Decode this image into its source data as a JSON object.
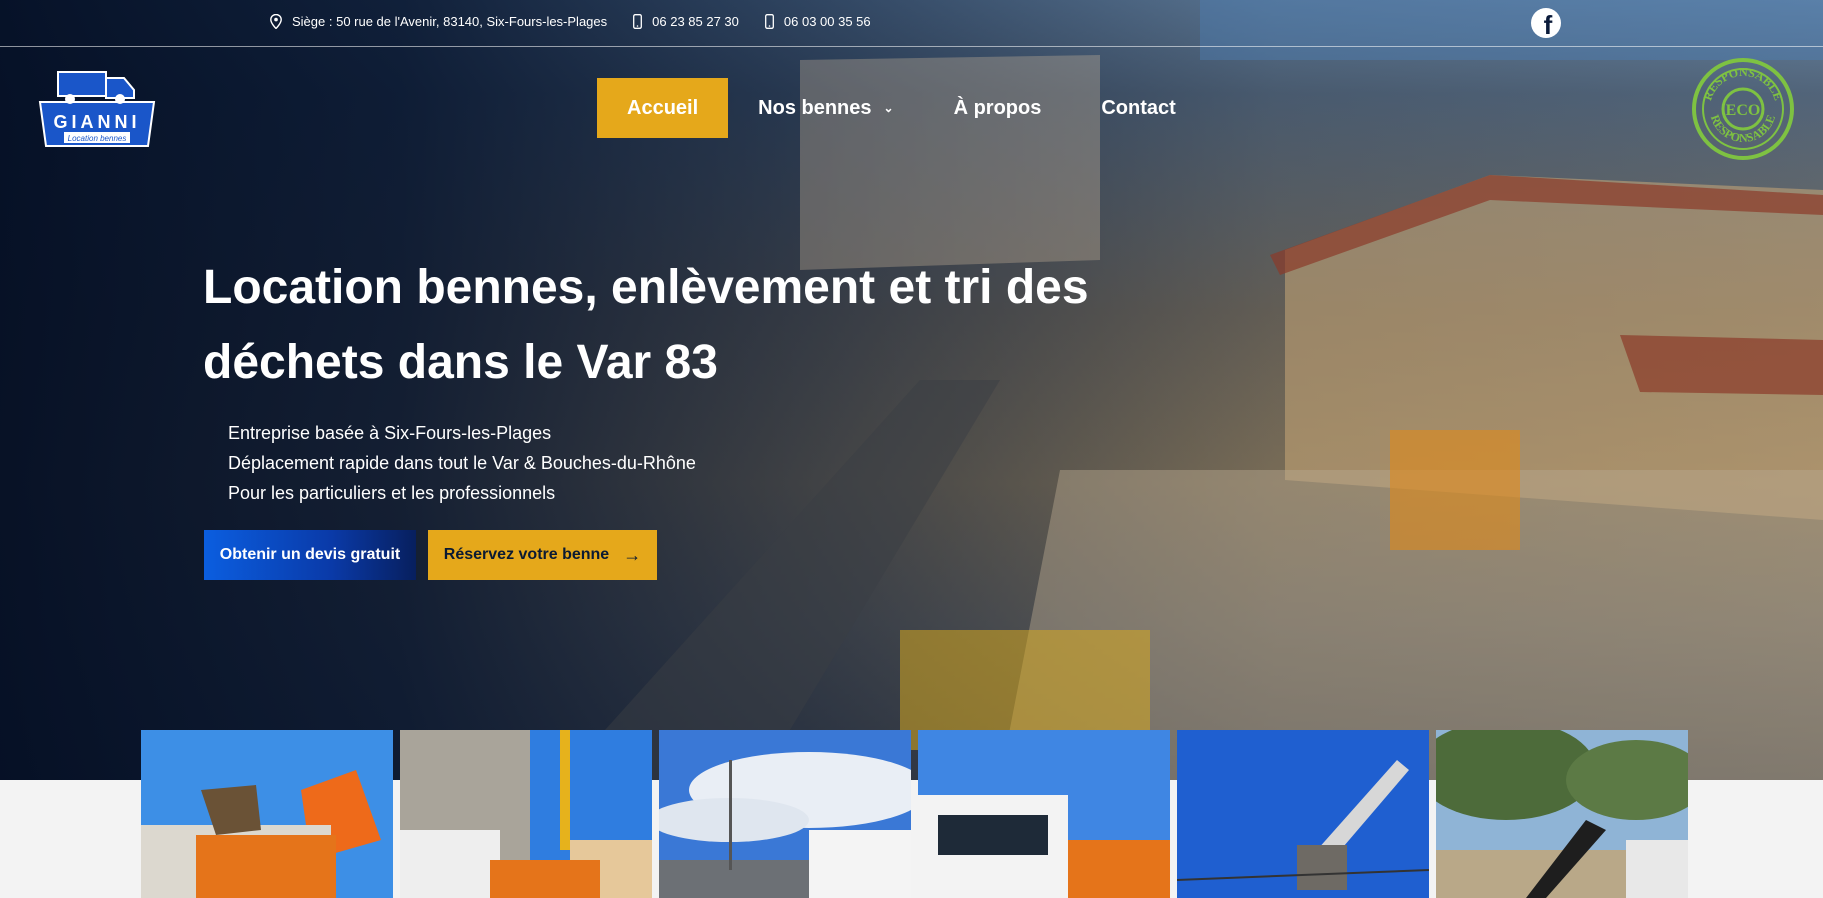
{
  "topbar": {
    "address": "Siège : 50 rue de l'Avenir, 83140, Six-Fours-les-Plages",
    "phone1": "06 23 85 27 30",
    "phone2": "06 03 00 35 56",
    "icons": [
      "location-pin-icon",
      "phone-icon",
      "phone-icon",
      "facebook-icon"
    ]
  },
  "logo": {
    "name": "GIANNI",
    "tagline": "Location bennes"
  },
  "nav": {
    "items": [
      "Accueil",
      "Nos bennes",
      "À propos",
      "Contact"
    ],
    "active": "Accueil"
  },
  "badge": {
    "top": "RESPONSABLE",
    "center": "ECO",
    "bottom": "RESPONSABLE"
  },
  "hero": {
    "title": "Location bennes, enlèvement et tri des déchets dans le Var 83",
    "bullets": [
      "Entreprise basée à Six-Fours-les-Plages",
      "Déplacement rapide dans tout le Var & Bouches-du-Rhône",
      "Pour les particuliers et les professionnels"
    ],
    "cta_quote": "Obtenir un devis gratuit",
    "cta_book": "Réservez votre benne"
  },
  "colors": {
    "accent": "#e5a81b",
    "primary": "#0b5ee0",
    "navy": "#071f5e",
    "eco": "#7ec242"
  },
  "gallery": [
    "truck-loader",
    "truck-crane",
    "truck-cloudy-sky",
    "truck-white-front",
    "grapple-crane",
    "excavator-trees"
  ]
}
